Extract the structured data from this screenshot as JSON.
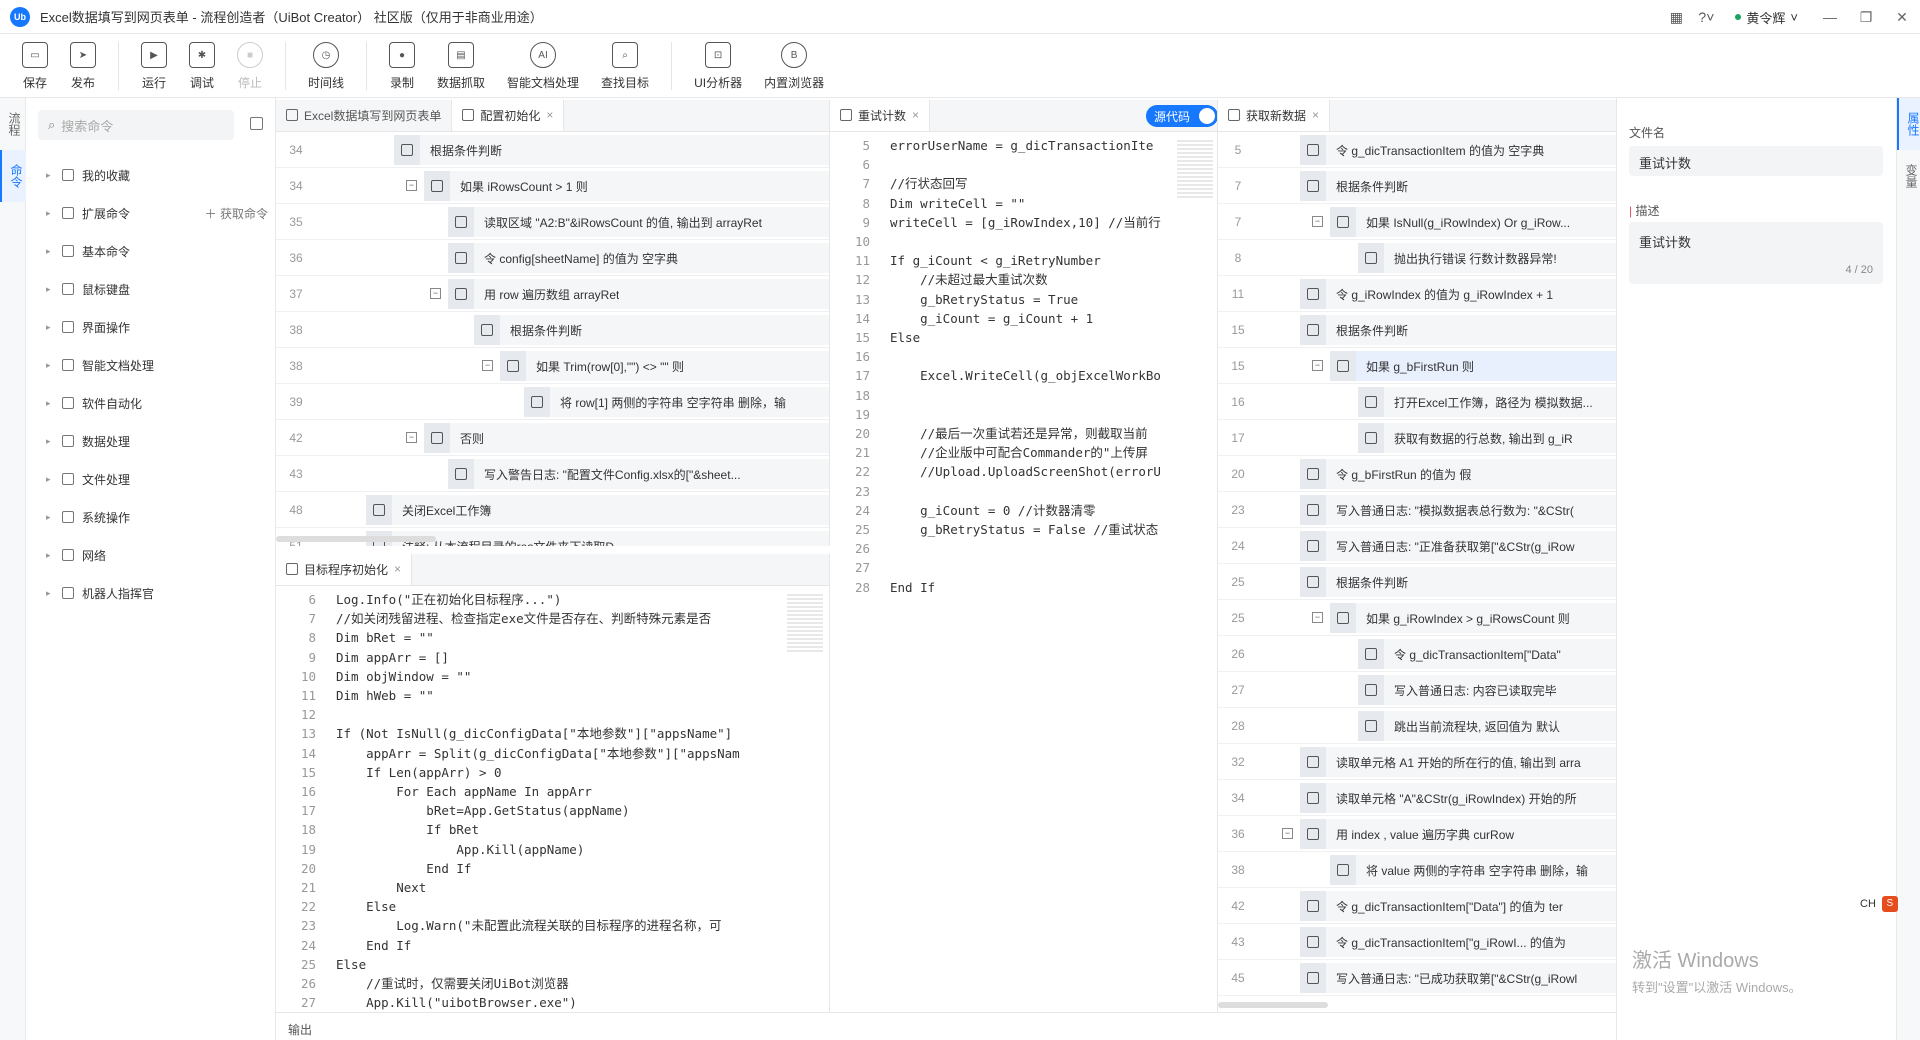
{
  "app": {
    "title": "Excel数据填写到网页表单 - 流程创造者（UiBot Creator） 社区版（仅用于非商业用途）",
    "logo": "Ub",
    "user": "黄令辉",
    "help_icon": "question-icon",
    "apps_icon": "grid-icon"
  },
  "toolbar": {
    "save": "保存",
    "publish": "发布",
    "run": "运行",
    "debug": "调试",
    "stop": "停止",
    "timeline": "时间线",
    "record": "录制",
    "data_capture": "数据抓取",
    "smart_doc": "智能文档处理",
    "find_target": "查找目标",
    "ui_analyzer": "UI分析器",
    "builtin_browser": "内置浏览器"
  },
  "left_rail": {
    "flow": "流程",
    "command": "命令"
  },
  "command_panel": {
    "search_placeholder": "搜索命令",
    "get_command": "获取命令",
    "items": [
      "我的收藏",
      "扩展命令",
      "基本命令",
      "鼠标键盘",
      "界面操作",
      "智能文档处理",
      "软件自动化",
      "数据处理",
      "文件处理",
      "系统操作",
      "网络",
      "机器人指挥官"
    ]
  },
  "panel_config": {
    "tabs": [
      "Excel数据填写到网页表单",
      "配置初始化"
    ],
    "rows": [
      {
        "ln": "34",
        "text": "根据条件判断"
      },
      {
        "ln": "34",
        "text": "如果 iRowsCount > 1 则"
      },
      {
        "ln": "35",
        "text": "读取区域 \"A2:B\"&iRowsCount 的值, 输出到  arrayRet"
      },
      {
        "ln": "36",
        "text": "令 config[sheetName] 的值为 空字典"
      },
      {
        "ln": "37",
        "text": "用 row 遍历数组 arrayRet"
      },
      {
        "ln": "38",
        "text": "根据条件判断"
      },
      {
        "ln": "38",
        "text": "如果 Trim(row[0],\"\") <> \"\" 则"
      },
      {
        "ln": "39",
        "text": "将 row[1] 两侧的字符串 空字符串 删除，输"
      },
      {
        "ln": "42",
        "text": "否则"
      },
      {
        "ln": "43",
        "text": "写入警告日志: \"配置文件Config.xlsx的[\"&sheet..."
      },
      {
        "ln": "48",
        "text": "关闭Excel工作簿"
      },
      {
        "ln": "51",
        "text": "注释: 从本流程目录的res文件夹下读取D"
      }
    ]
  },
  "panel_target": {
    "tab": "目标程序初始化",
    "lines": [
      {
        "n": "6",
        "code": "Log.Info(\"正在初始化目标程序...\")"
      },
      {
        "n": "7",
        "code": "//如关闭残留进程、检查指定exe文件是否存在、判断特殊元素是否"
      },
      {
        "n": "8",
        "code": "Dim bRet = \"\""
      },
      {
        "n": "9",
        "code": "Dim appArr = []"
      },
      {
        "n": "10",
        "code": "Dim objWindow = \"\""
      },
      {
        "n": "11",
        "code": "Dim hWeb = \"\""
      },
      {
        "n": "12",
        "code": ""
      },
      {
        "n": "13",
        "code": "If (Not IsNull(g_dicConfigData[\"本地参数\"][\"appsName\"]"
      },
      {
        "n": "14",
        "code": "    appArr = Split(g_dicConfigData[\"本地参数\"][\"appsNam"
      },
      {
        "n": "15",
        "code": "    If Len(appArr) > 0"
      },
      {
        "n": "16",
        "code": "        For Each appName In appArr"
      },
      {
        "n": "17",
        "code": "            bRet=App.GetStatus(appName)"
      },
      {
        "n": "18",
        "code": "            If bRet"
      },
      {
        "n": "19",
        "code": "                App.Kill(appName)"
      },
      {
        "n": "20",
        "code": "            End If"
      },
      {
        "n": "21",
        "code": "        Next"
      },
      {
        "n": "22",
        "code": "    Else"
      },
      {
        "n": "23",
        "code": "        Log.Warn(\"未配置此流程关联的目标程序的进程名称，可"
      },
      {
        "n": "24",
        "code": "    End If"
      },
      {
        "n": "25",
        "code": "Else"
      },
      {
        "n": "26",
        "code": "    //重试时，仅需要关闭UiBot浏览器"
      },
      {
        "n": "27",
        "code": "    App.Kill(\"uibotBrowser.exe\")"
      }
    ]
  },
  "panel_retry": {
    "tab": "重试计数",
    "source_toggle": "源代码",
    "lines": [
      {
        "n": "5",
        "code": "errorUserName = g_dicTransactionIte"
      },
      {
        "n": "6",
        "code": ""
      },
      {
        "n": "7",
        "code": "//行状态回写"
      },
      {
        "n": "8",
        "code": "Dim writeCell = \"\""
      },
      {
        "n": "9",
        "code": "writeCell = [g_iRowIndex,10] //当前行"
      },
      {
        "n": "10",
        "code": ""
      },
      {
        "n": "11",
        "code": "If g_iCount < g_iRetryNumber"
      },
      {
        "n": "12",
        "code": "    //未超过最大重试次数"
      },
      {
        "n": "13",
        "code": "    g_bRetryStatus = True"
      },
      {
        "n": "14",
        "code": "    g_iCount = g_iCount + 1"
      },
      {
        "n": "15",
        "code": "Else"
      },
      {
        "n": "16",
        "code": ""
      },
      {
        "n": "17",
        "code": "    Excel.WriteCell(g_objExcelWorkBo"
      },
      {
        "n": "18",
        "code": ""
      },
      {
        "n": "19",
        "code": ""
      },
      {
        "n": "20",
        "code": "    //最后一次重试若还是异常，则截取当前"
      },
      {
        "n": "21",
        "code": "    //企业版中可配合Commander的\"上传屏"
      },
      {
        "n": "22",
        "code": "    //Upload.UploadScreenShot(errorU"
      },
      {
        "n": "23",
        "code": ""
      },
      {
        "n": "24",
        "code": "    g_iCount = 0 //计数器清零"
      },
      {
        "n": "25",
        "code": "    g_bRetryStatus = False //重试状态"
      },
      {
        "n": "26",
        "code": ""
      },
      {
        "n": "27",
        "code": ""
      },
      {
        "n": "28",
        "code": "End If"
      }
    ]
  },
  "panel_fetch": {
    "tab": "获取新数据",
    "rows": [
      {
        "ln": "5",
        "text": "令 g_dicTransactionItem 的值为 空字典"
      },
      {
        "ln": "7",
        "text": "根据条件判断"
      },
      {
        "ln": "7",
        "text": "如果 IsNull(g_iRowIndex) Or g_iRow..."
      },
      {
        "ln": "8",
        "text": "抛出执行错误 行数计数器异常!"
      },
      {
        "ln": "11",
        "text": "令 g_iRowIndex 的值为 g_iRowIndex + 1"
      },
      {
        "ln": "15",
        "text": "根据条件判断"
      },
      {
        "ln": "15",
        "text": "如果 g_bFirstRun 则"
      },
      {
        "ln": "16",
        "text": "打开Excel工作簿，路径为 模拟数据..."
      },
      {
        "ln": "17",
        "text": "获取有数据的行总数, 输出到  g_iR"
      },
      {
        "ln": "20",
        "text": "令 g_bFirstRun 的值为 假"
      },
      {
        "ln": "23",
        "text": "写入普通日志: \"模拟数据表总行数为: \"&CStr("
      },
      {
        "ln": "24",
        "text": "写入普通日志: \"正准备获取第[\"&CStr(g_iRow"
      },
      {
        "ln": "25",
        "text": "根据条件判断"
      },
      {
        "ln": "25",
        "text": "如果 g_iRowIndex > g_iRowsCount 则"
      },
      {
        "ln": "26",
        "text": "令 g_dicTransactionItem[\"Data\""
      },
      {
        "ln": "27",
        "text": "写入普通日志: 内容已读取完毕"
      },
      {
        "ln": "28",
        "text": "跳出当前流程块, 返回值为  默认"
      },
      {
        "ln": "32",
        "text": "读取单元格 A1 开始的所在行的值, 输出到  arra"
      },
      {
        "ln": "34",
        "text": "读取单元格 \"A\"&CStr(g_iRowIndex) 开始的所"
      },
      {
        "ln": "36",
        "text": "用 index , value 遍历字典 curRow"
      },
      {
        "ln": "38",
        "text": "将 value 两侧的字符串 空字符串 删除，输"
      },
      {
        "ln": "42",
        "text": "令 g_dicTransactionItem[\"Data\"] 的值为 ter"
      },
      {
        "ln": "43",
        "text": "令 g_dicTransactionItem[\"g_iRowI... 的值为"
      },
      {
        "ln": "45",
        "text": "写入普通日志: \"已成功获取第[\"&CStr(g_iRowl"
      }
    ]
  },
  "properties": {
    "file_label": "文件名",
    "file_value": "重试计数",
    "desc_label": "描述",
    "desc_value": "重试计数",
    "desc_count": "4 / 20",
    "rail_property": "属性",
    "rail_variable": "变量"
  },
  "output_label": "输出",
  "ime": {
    "lang": "CH",
    "icon": "S"
  },
  "watermark": {
    "line1": "激活 Windows",
    "line2": "转到\"设置\"以激活 Windows。"
  }
}
